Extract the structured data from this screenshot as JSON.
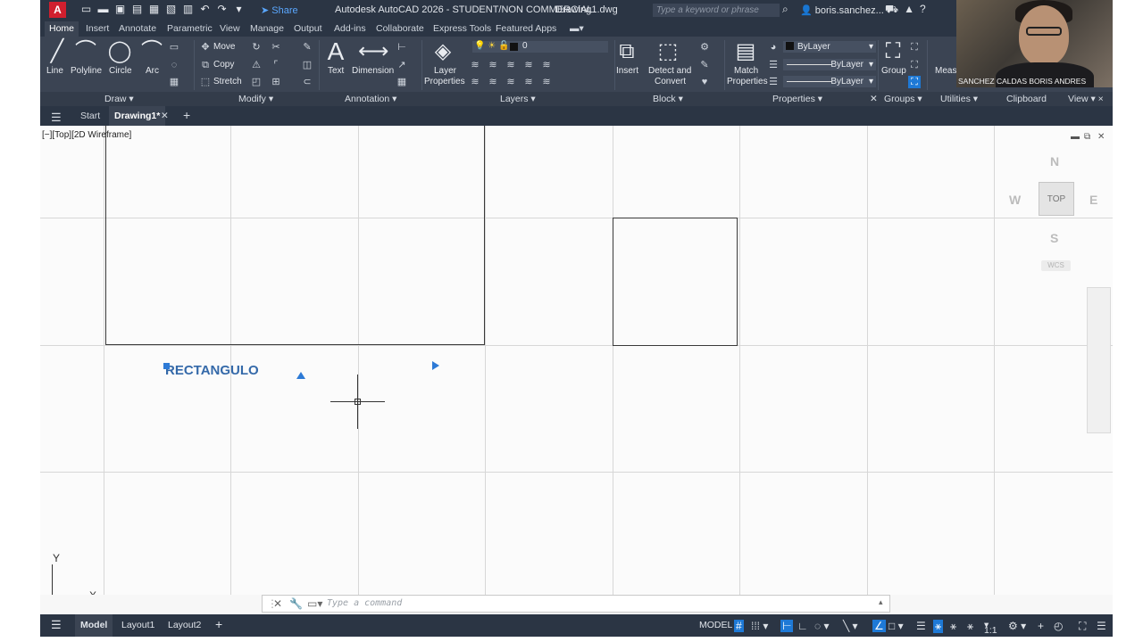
{
  "titlebar": {
    "app_title": "Autodesk AutoCAD 2026 - STUDENT/NON COMMERCIAL",
    "doc_title": "Drawing1.dwg",
    "share_label": "Share",
    "search_placeholder": "Type a keyword or phrase",
    "user_label": "boris.sanchez..."
  },
  "tabs": [
    "Home",
    "Insert",
    "Annotate",
    "Parametric",
    "View",
    "Manage",
    "Output",
    "Add-ins",
    "Collaborate",
    "Express Tools",
    "Featured Apps"
  ],
  "ribbon": {
    "draw": {
      "line": "Line",
      "polyline": "Polyline",
      "circle": "Circle",
      "arc": "Arc",
      "panel": "Draw"
    },
    "modify": {
      "move": "Move",
      "copy": "Copy",
      "stretch": "Stretch",
      "panel": "Modify"
    },
    "annotation": {
      "text": "Text",
      "dimension": "Dimension",
      "panel": "Annotation"
    },
    "layers": {
      "layer_properties_1": "Layer",
      "layer_properties_2": "Properties",
      "current_layer": "0",
      "panel": "Layers"
    },
    "block": {
      "insert": "Insert",
      "detect_1": "Detect and",
      "detect_2": "Convert",
      "panel": "Block"
    },
    "properties": {
      "match_1": "Match",
      "match_2": "Properties",
      "color": "ByLayer",
      "linetype": "ByLayer",
      "lineweight": "ByLayer",
      "panel": "Properties"
    },
    "groups": {
      "group": "Group",
      "panel": "Groups"
    },
    "utilities": {
      "measure": "Measu",
      "panel": "Utilities"
    },
    "clipboard": {
      "panel": "Clipboard"
    },
    "view": {
      "panel": "View"
    }
  },
  "filetabs": {
    "start": "Start",
    "drawing": "Drawing1*"
  },
  "viewport": {
    "label": "[−][Top][2D Wireframe]",
    "text_object": "RECTANGULO"
  },
  "viewcube": {
    "n": "N",
    "s": "S",
    "e": "E",
    "w": "W",
    "top": "TOP",
    "wcs": "WCS"
  },
  "ucs": {
    "x": "X",
    "y": "Y"
  },
  "command": {
    "placeholder": "Type  a  command"
  },
  "statusbar": {
    "model_tab": "Model",
    "layout1": "Layout1",
    "layout2": "Layout2",
    "model_space": "MODEL",
    "scale": "1:1"
  },
  "webcam": {
    "name": "SANCHEZ CALDAS BORIS ANDRES"
  },
  "icons": {
    "app_logo": "autocad-logo",
    "cursor": "crosshair-cursor"
  },
  "colors": {
    "accent": "#1e79d6",
    "app_logo": "#d01f2e",
    "text_object": "#3469a9"
  }
}
